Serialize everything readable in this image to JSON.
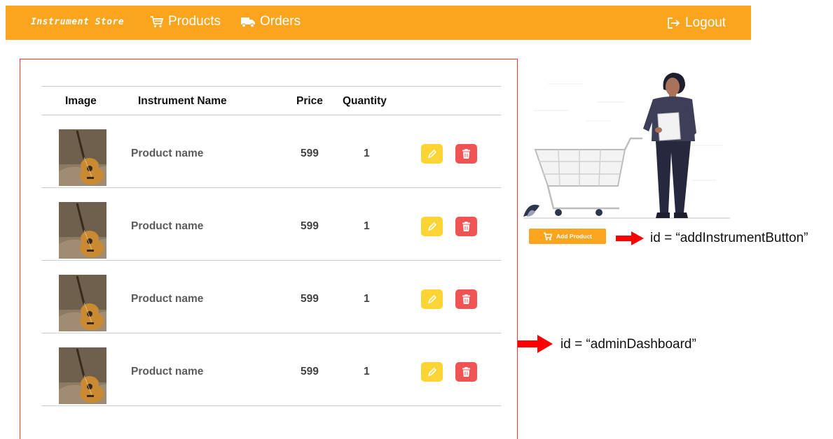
{
  "navbar": {
    "brand": "Instrument Store",
    "products": "Products",
    "orders": "Orders",
    "logout": "Logout"
  },
  "table": {
    "headers": {
      "image": "Image",
      "name": "Instrument Name",
      "price": "Price",
      "quantity": "Quantity"
    },
    "rows": [
      {
        "name": "Product name",
        "price": "599",
        "quantity": "1"
      },
      {
        "name": "Product name",
        "price": "599",
        "quantity": "1"
      },
      {
        "name": "Product name",
        "price": "599",
        "quantity": "1"
      },
      {
        "name": "Product name",
        "price": "599",
        "quantity": "1"
      }
    ]
  },
  "add_button": {
    "label": "Add Product"
  },
  "annotations": {
    "add_button_id": "id = “addInstrumentButton”",
    "dashboard_id": "id = “adminDashboard”"
  },
  "colors": {
    "navbar": "#fba51f",
    "edit": "#fcd535",
    "delete": "#f05452",
    "border": "#e23b3b",
    "arrow": "#ff0000"
  },
  "icons": {
    "products": "cart-icon",
    "orders": "truck-icon",
    "logout": "logout-icon",
    "edit": "pencil-icon",
    "delete": "trash-icon",
    "add": "cart-icon"
  }
}
